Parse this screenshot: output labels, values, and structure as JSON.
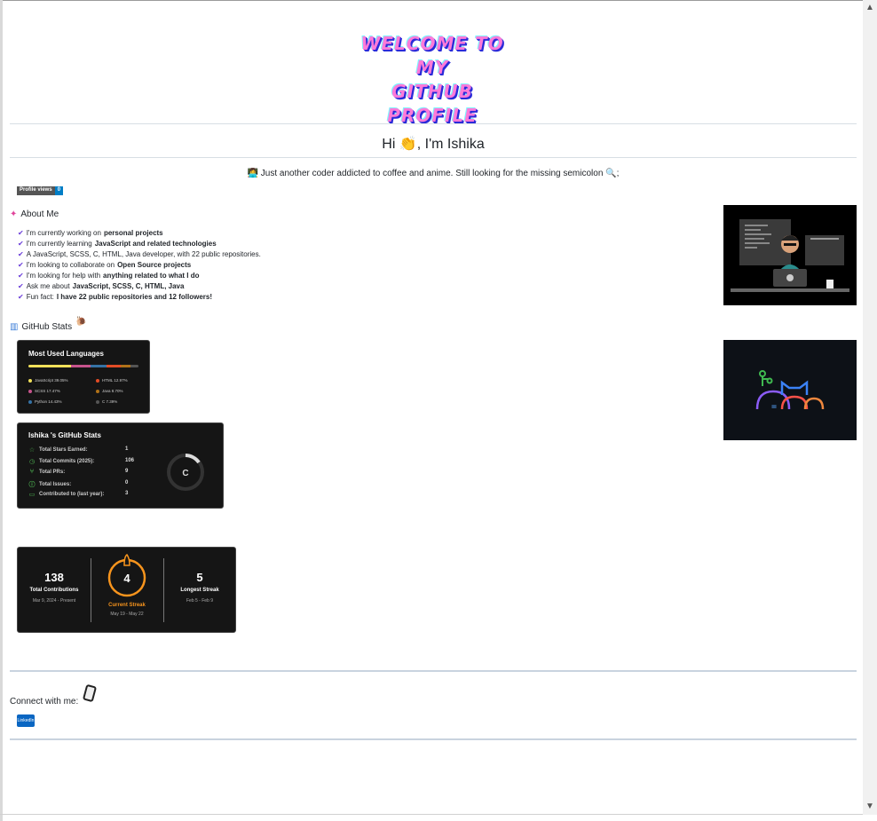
{
  "banner": {
    "line1": "WELCOME TO MY",
    "line2": "GITHUB PROFILE"
  },
  "header": {
    "greeting": "Hi 👏, I'm Ishika"
  },
  "tagline": "👩‍💻 Just another coder addicted to coffee and anime. Still looking for the missing semicolon 🔍;",
  "profile_views": {
    "label": "Profile views",
    "count": "0"
  },
  "about": {
    "title": "About Me",
    "items": [
      {
        "pre": "I'm currently working on ",
        "bold": "personal projects",
        "post": ""
      },
      {
        "pre": "I'm currently learning ",
        "bold": "JavaScript and related technologies",
        "post": ""
      },
      {
        "pre": "A JavaScript, SCSS, C, HTML, Java developer, with 22 public repositories.",
        "bold": "",
        "post": ""
      },
      {
        "pre": "I'm looking to collaborate on ",
        "bold": "Open Source projects",
        "post": ""
      },
      {
        "pre": "I'm looking for help with ",
        "bold": "anything related to what I do",
        "post": ""
      },
      {
        "pre": "Ask me about ",
        "bold": "JavaScript, SCSS, C, HTML, Java",
        "post": ""
      },
      {
        "pre": "Fun fact: ",
        "bold": "I have 22 public repositories and 12 followers!",
        "post": ""
      }
    ]
  },
  "github_stats": {
    "title": "GitHub Stats"
  },
  "languages": {
    "title": "Most Used Languages",
    "items": [
      {
        "label": "JavaScript 39.05%",
        "color": "#f1e05a",
        "pct": 39.05
      },
      {
        "label": "SCSS 17.47%",
        "color": "#c6538c",
        "pct": 17.47
      },
      {
        "label": "Python 14.43%",
        "color": "#3572a5",
        "pct": 14.43
      },
      {
        "label": "HTML 12.97%",
        "color": "#e34c26",
        "pct": 12.97
      },
      {
        "label": "Java 8.70%",
        "color": "#b07219",
        "pct": 8.7
      },
      {
        "label": "C 7.39%",
        "color": "#555555",
        "pct": 7.39
      }
    ]
  },
  "stats": {
    "title": "Ishika 's GitHub Stats",
    "rows": [
      {
        "label": "Total Stars Earned:",
        "value": "1",
        "icon": "☆"
      },
      {
        "label": "Total Commits (2025):",
        "value": "106",
        "icon": "◷"
      },
      {
        "label": "Total PRs:",
        "value": "9",
        "icon": "⑂"
      },
      {
        "label": "Total Issues:",
        "value": "0",
        "icon": "ⓘ"
      },
      {
        "label": "Contributed to (last year):",
        "value": "3",
        "icon": "▭"
      }
    ],
    "grade": "C"
  },
  "streak": {
    "total": {
      "num": "138",
      "label": "Total Contributions",
      "sub": "Mar 9, 2024 - Present"
    },
    "current": {
      "num": "4",
      "label": "Current Streak",
      "sub": "May 19 - May 22"
    },
    "longest": {
      "num": "5",
      "label": "Longest Streak",
      "sub": "Feb 5 - Feb 9"
    }
  },
  "connect": {
    "label": "Connect with me:",
    "linkedin": "LinkedIn"
  },
  "colors": {
    "accent_orange": "#f7941d",
    "checkmark": "#6a3dd9"
  }
}
